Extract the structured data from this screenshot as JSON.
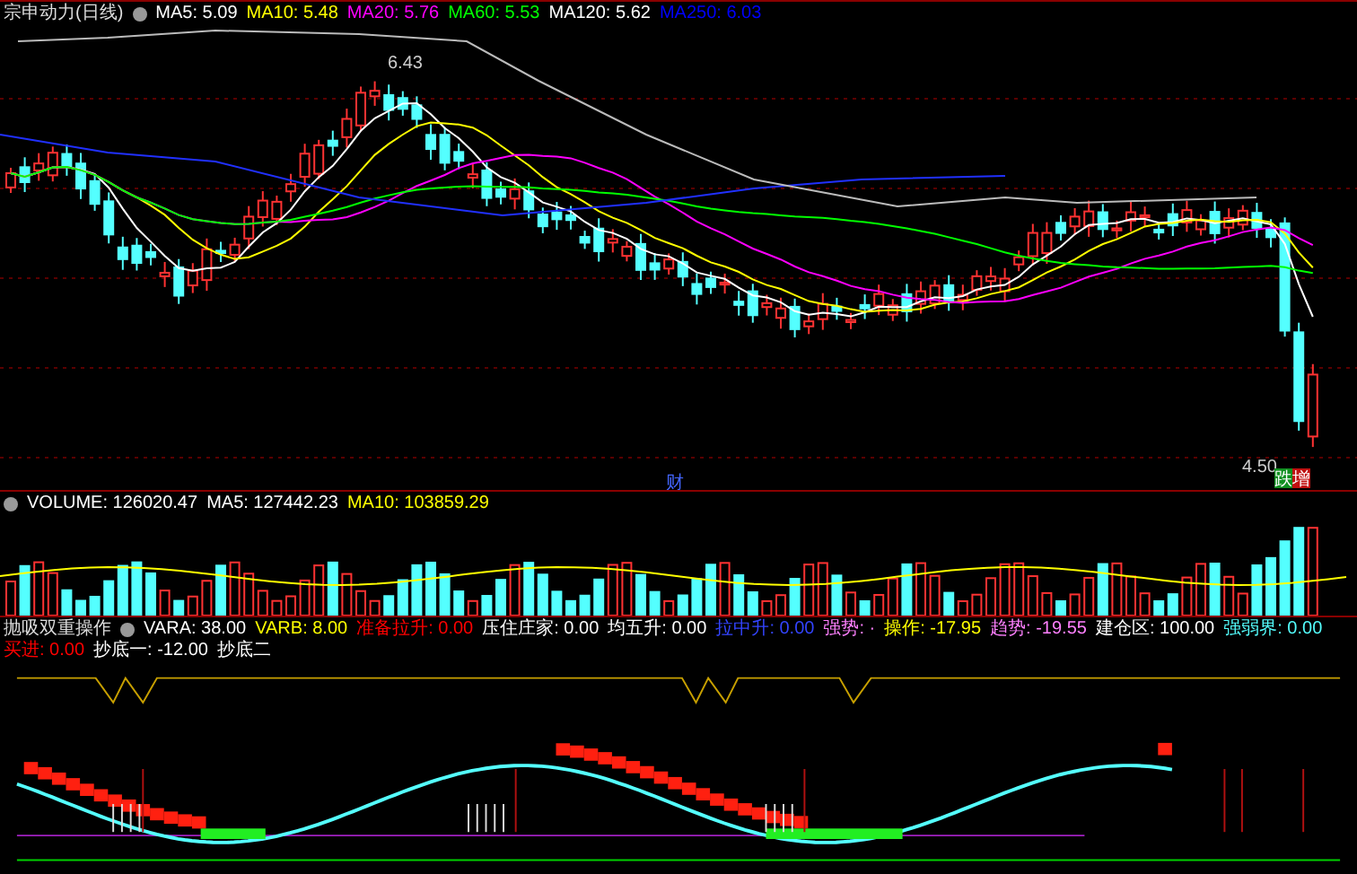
{
  "main_panel": {
    "title": "宗申动力(日线)",
    "legend": [
      {
        "text": "MA5: 5.09",
        "color": "#ffffff"
      },
      {
        "text": "MA10: 5.48",
        "color": "#ffff00"
      },
      {
        "text": "MA20: 5.76",
        "color": "#ff00ff"
      },
      {
        "text": "MA60: 5.53",
        "color": "#00ff00"
      },
      {
        "text": "MA120: 5.62",
        "color": "#ffffff"
      },
      {
        "text": "MA250: 6.03",
        "color": "#0000ff"
      }
    ],
    "high_label": "6.43",
    "low_label": "4.50",
    "marker": "财",
    "low_tags": [
      "跌",
      "增"
    ]
  },
  "volume_panel": {
    "legend": [
      {
        "text": "VOLUME: 126020.47",
        "color": "#ffffff"
      },
      {
        "text": "MA5: 127442.23",
        "color": "#ffffff"
      },
      {
        "text": "MA10: 103859.29",
        "color": "#ffff00"
      }
    ]
  },
  "indicator_panel": {
    "title": "抛吸双重操作",
    "legend": [
      {
        "text": "VARA: 38.00",
        "color": "#ffffff"
      },
      {
        "text": "VARB: 8.00",
        "color": "#ffff00"
      },
      {
        "text": "准备拉升: 0.00",
        "color": "#ff0000"
      },
      {
        "text": "压住庄家: 0.00",
        "color": "#ffffff"
      },
      {
        "text": "均五升: 0.00",
        "color": "#ffffff"
      },
      {
        "text": "拉中升: 0.00",
        "color": "#3344ff"
      },
      {
        "text": "强势: ·",
        "color": "#ff80ff"
      },
      {
        "text": "操作: -17.95",
        "color": "#ffff00"
      },
      {
        "text": "趋势: -19.55",
        "color": "#ff80ff"
      },
      {
        "text": "建仓区: 100.00",
        "color": "#ffffff"
      },
      {
        "text": "强弱界: 0.00",
        "color": "#54ffff"
      },
      {
        "text": "买进: 0.00",
        "color": "#ff0000"
      },
      {
        "text": "抄底一: -12.00",
        "color": "#ffffff"
      },
      {
        "text": "抄底二",
        "color": "#ffffff"
      }
    ]
  }
}
